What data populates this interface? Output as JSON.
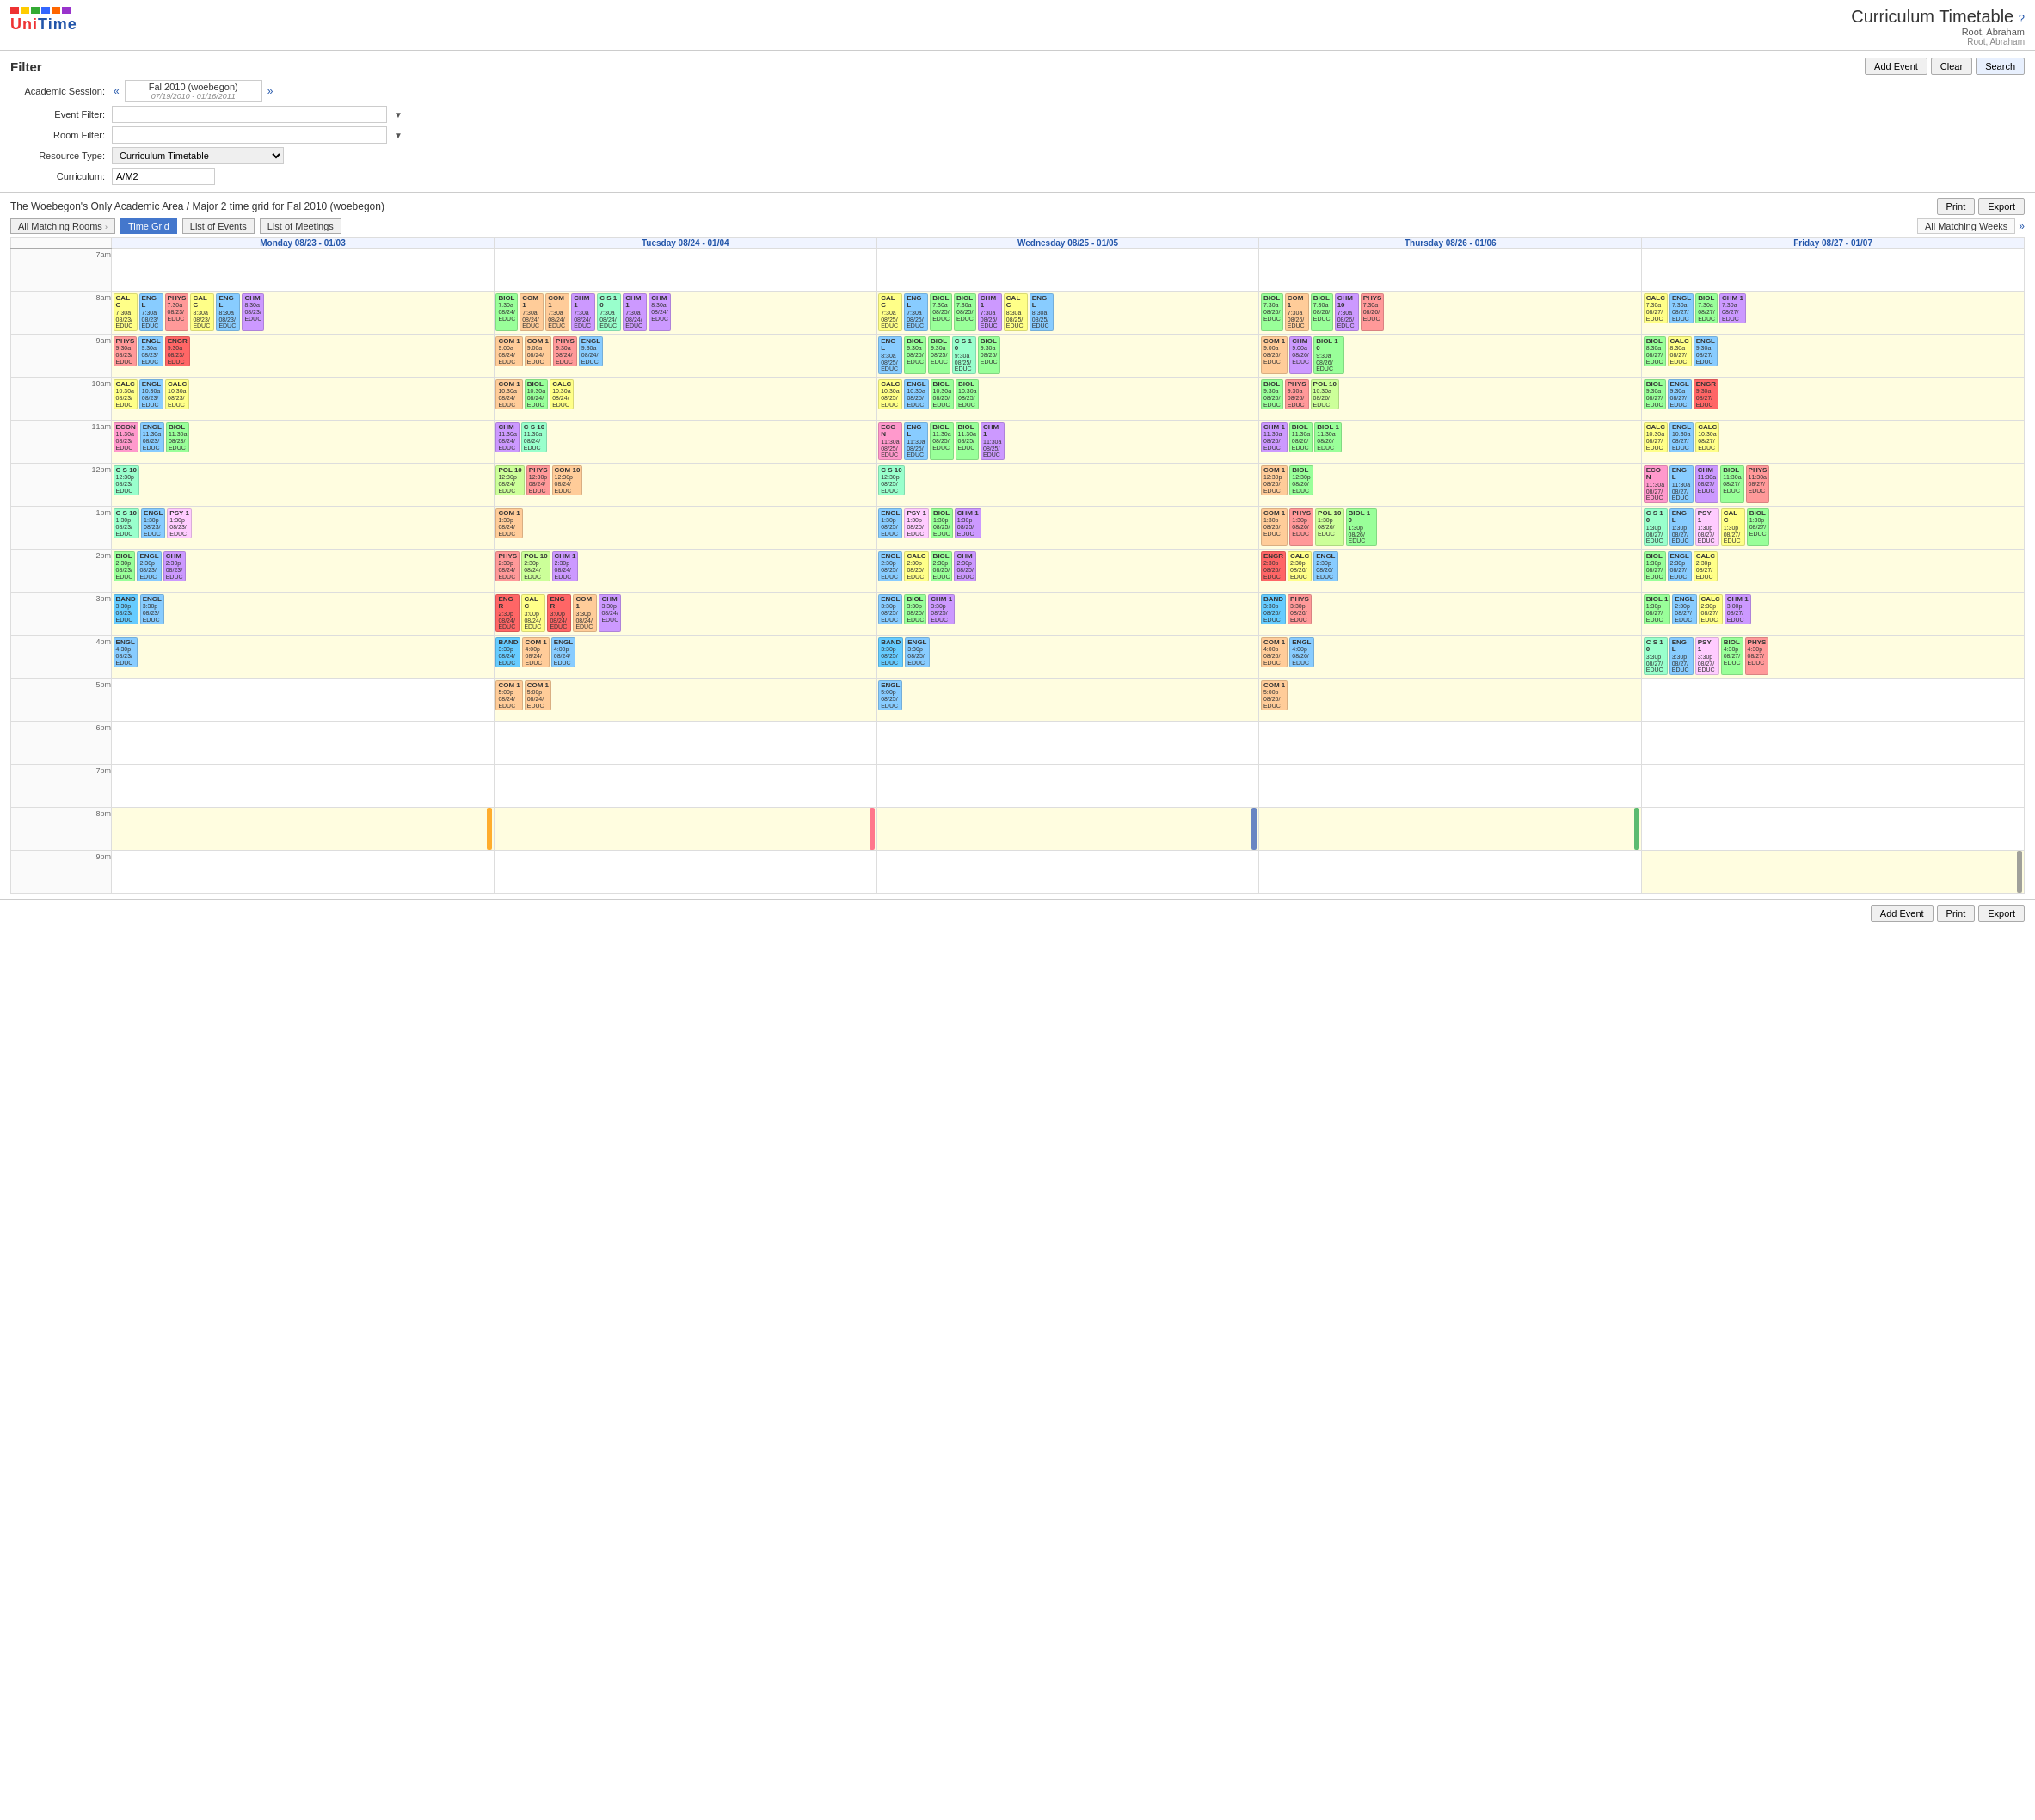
{
  "header": {
    "app_title": "Curriculum Timetable",
    "help_icon": "?",
    "user_name": "Root, Abraham",
    "user_sub": "Root, Abraham"
  },
  "filter": {
    "title": "Filter",
    "buttons": {
      "add_event": "Add Event",
      "clear": "Clear",
      "search": "Search"
    },
    "academic_session": {
      "label": "Academic Session:",
      "value": "Fal 2010 (woebegon)",
      "dates": "07/19/2010 - 01/16/2011"
    },
    "event_filter": {
      "label": "Event Filter:",
      "placeholder": ""
    },
    "room_filter": {
      "label": "Room Filter:",
      "placeholder": ""
    },
    "resource_type": {
      "label": "Resource Type:",
      "value": "Curriculum Timetable"
    },
    "curriculum": {
      "label": "Curriculum:",
      "value": "A/M2"
    }
  },
  "timetable": {
    "section_title": "The Woebegon's Only Academic Area / Major 2 time grid for Fal 2010 (woebegon)",
    "tabs": [
      {
        "label": "All Matching Rooms",
        "active": false
      },
      {
        "label": "Time Grid",
        "active": true
      },
      {
        "label": "List of Events",
        "active": false
      },
      {
        "label": "List of Meetings",
        "active": false
      }
    ],
    "weeks_nav": {
      "label": "All Matching Weeks",
      "arrow": "»"
    },
    "print_label": "Print",
    "export_label": "Export",
    "days": [
      {
        "label": "Monday 08/23 - 01/03"
      },
      {
        "label": "Tuesday 08/24 - 01/04"
      },
      {
        "label": "Wednesday 08/25 - 01/05"
      },
      {
        "label": "Thursday 08/26 - 01/06"
      },
      {
        "label": "Friday 08/27 - 01/07"
      }
    ],
    "time_slots": [
      "7am",
      "8am",
      "9am",
      "10am",
      "11am",
      "12pm",
      "1pm",
      "2pm",
      "3pm",
      "4pm",
      "5pm",
      "6pm",
      "7pm",
      "8pm",
      "9pm"
    ]
  },
  "bottom_toolbar": {
    "add_event": "Add Event",
    "print": "Print",
    "export": "Export"
  }
}
